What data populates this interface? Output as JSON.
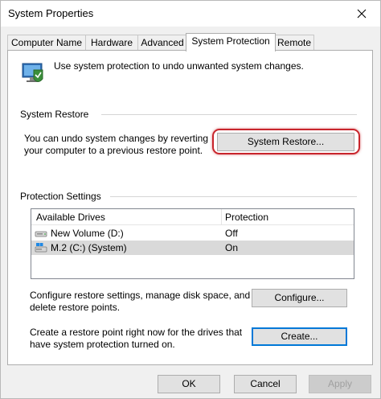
{
  "window": {
    "title": "System Properties"
  },
  "tabs": [
    {
      "label": "Computer Name",
      "active": false
    },
    {
      "label": "Hardware",
      "active": false
    },
    {
      "label": "Advanced",
      "active": false
    },
    {
      "label": "System Protection",
      "active": true
    },
    {
      "label": "Remote",
      "active": false
    }
  ],
  "intro": {
    "text": "Use system protection to undo unwanted system changes."
  },
  "system_restore": {
    "group_title": "System Restore",
    "description_line1": "You can undo system changes by reverting",
    "description_line2": "your computer to a previous restore point.",
    "button_label": "System Restore..."
  },
  "protection_settings": {
    "group_title": "Protection Settings",
    "columns": [
      "Available Drives",
      "Protection"
    ],
    "drives": [
      {
        "name": "New Volume (D:)",
        "protection": "Off",
        "icon": "drive-icon"
      },
      {
        "name": "M.2 (C:) (System)",
        "protection": "On",
        "icon": "system-drive-icon"
      }
    ],
    "configure_text_line1": "Configure restore settings, manage disk space, and",
    "configure_text_line2": "delete restore points.",
    "configure_button": "Configure...",
    "create_text_line1": "Create a restore point right now for the drives that",
    "create_text_line2": "have system protection turned on.",
    "create_button": "Create..."
  },
  "footer": {
    "ok": "OK",
    "cancel": "Cancel",
    "apply": "Apply"
  },
  "colors": {
    "highlight": "#c8252c",
    "focus": "#0078d7",
    "selected_row": "#d9d9d9"
  }
}
